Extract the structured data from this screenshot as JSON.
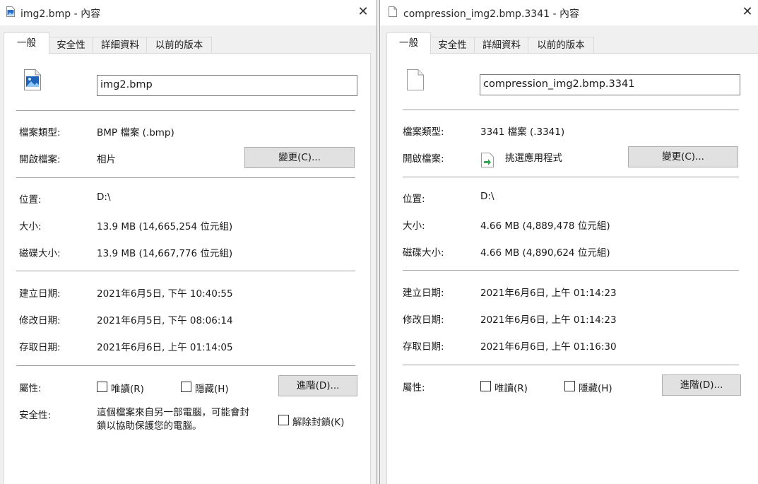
{
  "left": {
    "window_title": "img2.bmp - 內容",
    "tabs": [
      "一般",
      "安全性",
      "詳細資料",
      "以前的版本"
    ],
    "file_name": "img2.bmp",
    "labels": {
      "type": "檔案類型:",
      "open_with": "開啟檔案:",
      "location": "位置:",
      "size": "大小:",
      "size_on_disk": "磁碟大小:",
      "created": "建立日期:",
      "modified": "修改日期:",
      "accessed": "存取日期:",
      "attributes": "屬性:",
      "security": "安全性:"
    },
    "values": {
      "type": "BMP 檔案 (.bmp)",
      "open_with": "相片",
      "location": "D:\\",
      "size": "13.9 MB (14,665,254 位元組)",
      "size_on_disk": "13.9 MB (14,667,776 位元組)",
      "created": "2021年6月5日, 下午 10:40:55",
      "modified": "2021年6月5日, 下午 08:06:14",
      "accessed": "2021年6月6日, 上午 01:14:05"
    },
    "change_button": "變更(C)...",
    "readonly_label": "唯讀(R)",
    "hidden_label": "隱藏(H)",
    "advanced_button": "進階(D)...",
    "security_text_line1": "這個檔案來自另一部電腦，可能會封",
    "security_text_line2": "鎖以協助保護您的電腦。",
    "unblock_label": "解除封鎖(K)",
    "file_icon": "image-file-icon"
  },
  "right": {
    "window_title": "compression_img2.bmp.3341 - 內容",
    "tabs": [
      "一般",
      "安全性",
      "詳細資料",
      "以前的版本"
    ],
    "file_name": "compression_img2.bmp.3341",
    "labels": {
      "type": "檔案類型:",
      "open_with": "開啟檔案:",
      "location": "位置:",
      "size": "大小:",
      "size_on_disk": "磁碟大小:",
      "created": "建立日期:",
      "modified": "修改日期:",
      "accessed": "存取日期:",
      "attributes": "屬性:"
    },
    "values": {
      "type": "3341 檔案 (.3341)",
      "open_with": "挑選應用程式",
      "location": "D:\\",
      "size": "4.66 MB (4,889,478 位元組)",
      "size_on_disk": "4.66 MB (4,890,624 位元組)",
      "created": "2021年6月6日, 上午 01:14:23",
      "modified": "2021年6月6日, 上午 01:14:23",
      "accessed": "2021年6月6日, 上午 01:16:30"
    },
    "change_button": "變更(C)...",
    "readonly_label": "唯讀(R)",
    "hidden_label": "隱藏(H)",
    "advanced_button": "進階(D)...",
    "file_icon": "blank-file-icon",
    "open_with_icon": "pick-app-icon"
  },
  "colors": {
    "window_bg": "#f0f0f0",
    "panel_bg": "#ffffff",
    "button_bg": "#e1e1e1",
    "separator": "#a0a0a0"
  }
}
